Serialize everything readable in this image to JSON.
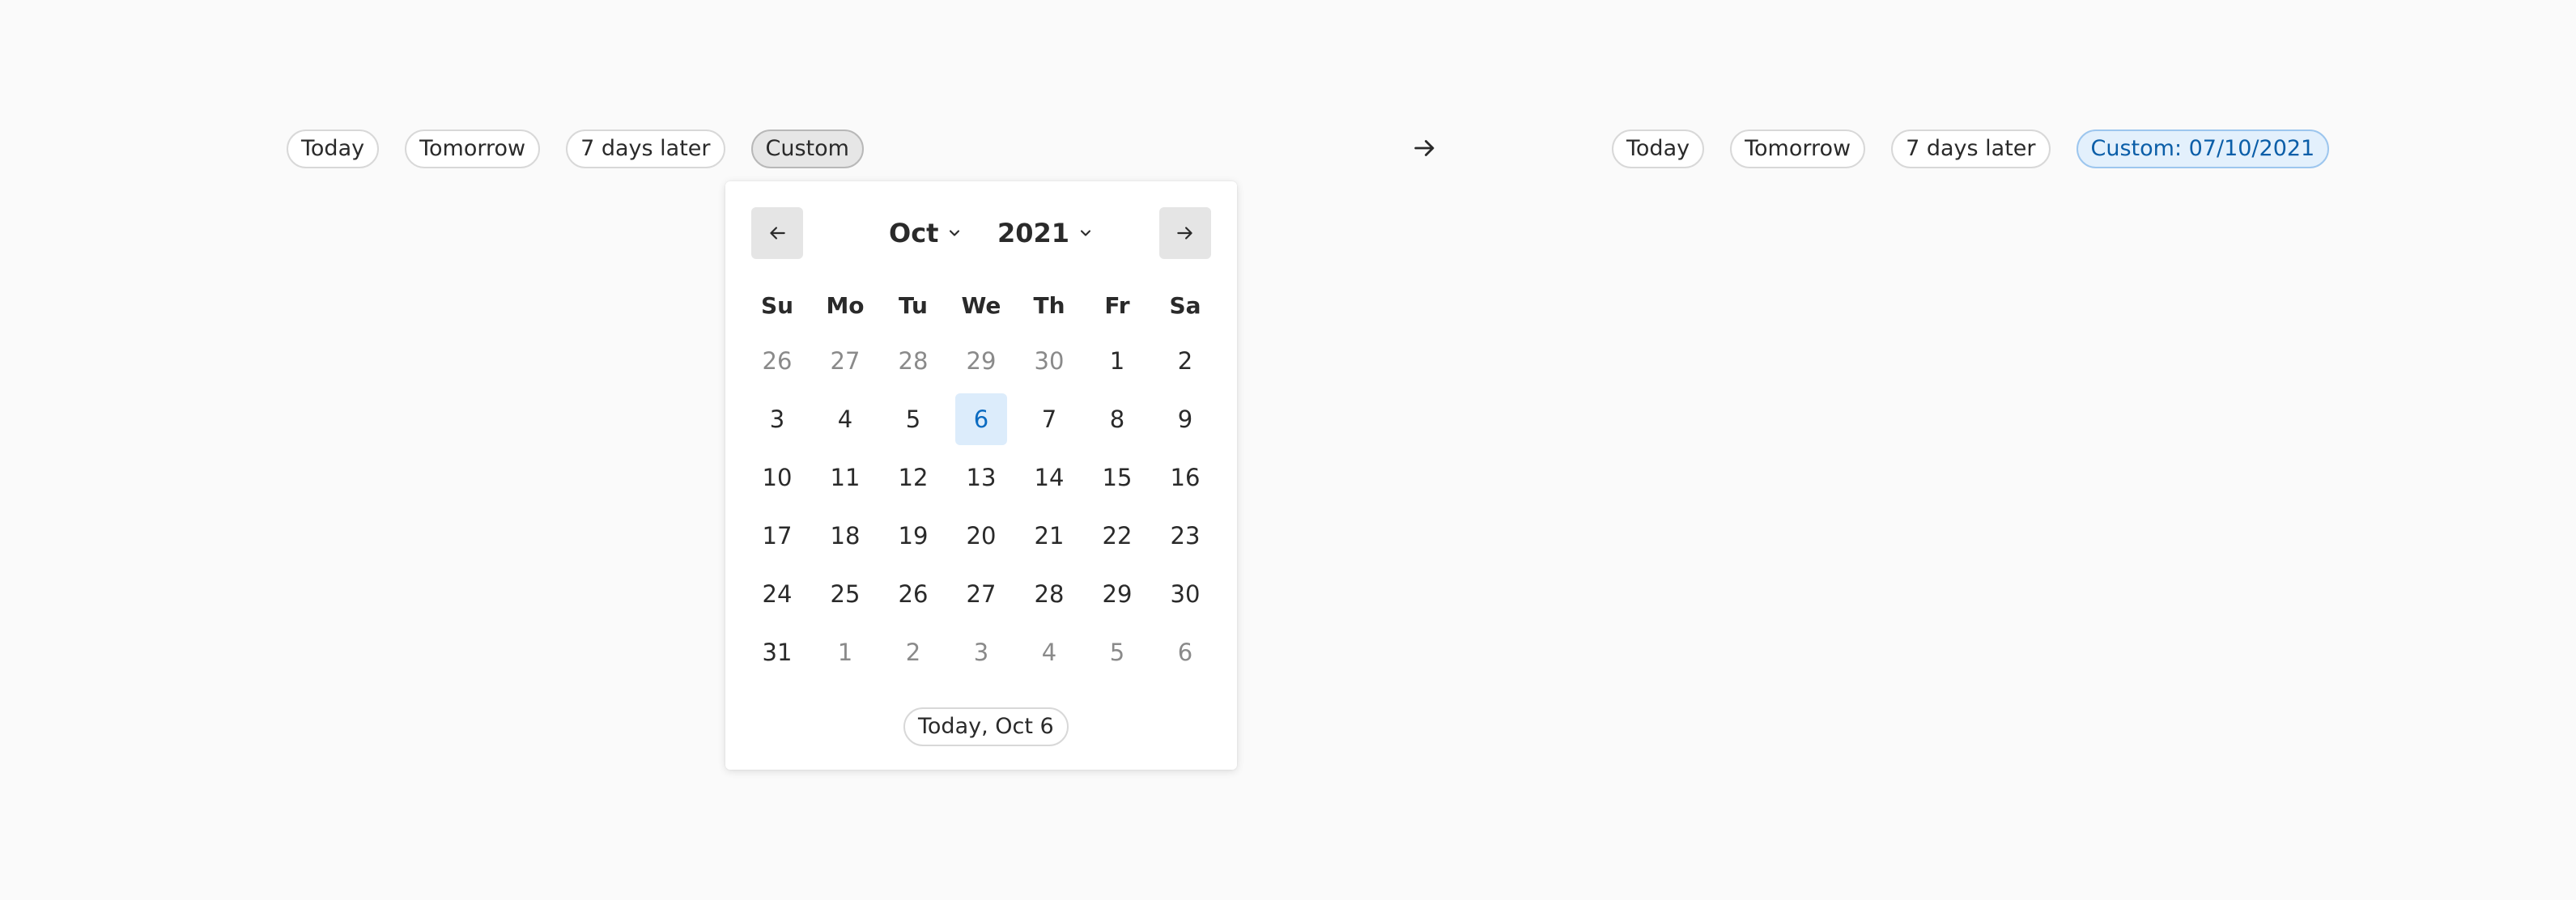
{
  "left_chips": [
    {
      "label": "Today"
    },
    {
      "label": "Tomorrow"
    },
    {
      "label": "7 days later"
    },
    {
      "label": "Custom"
    }
  ],
  "arrow_icon": "arrow-right-icon",
  "right_chips": [
    {
      "label": "Today"
    },
    {
      "label": "Tomorrow"
    },
    {
      "label": "7 days later"
    },
    {
      "label": "Custom: 07/10/2021"
    }
  ],
  "calendar": {
    "prev_icon": "arrow-left-icon",
    "next_icon": "arrow-right-icon",
    "month": "Oct",
    "year": "2021",
    "weekdays": [
      "Su",
      "Mo",
      "Tu",
      "We",
      "Th",
      "Fr",
      "Sa"
    ],
    "weeks": [
      [
        {
          "d": "26",
          "out": true
        },
        {
          "d": "27",
          "out": true
        },
        {
          "d": "28",
          "out": true
        },
        {
          "d": "29",
          "out": true
        },
        {
          "d": "30",
          "out": true
        },
        {
          "d": "1"
        },
        {
          "d": "2"
        }
      ],
      [
        {
          "d": "3"
        },
        {
          "d": "4"
        },
        {
          "d": "5"
        },
        {
          "d": "6",
          "today": true
        },
        {
          "d": "7"
        },
        {
          "d": "8"
        },
        {
          "d": "9"
        }
      ],
      [
        {
          "d": "10"
        },
        {
          "d": "11"
        },
        {
          "d": "12"
        },
        {
          "d": "13"
        },
        {
          "d": "14"
        },
        {
          "d": "15"
        },
        {
          "d": "16"
        }
      ],
      [
        {
          "d": "17"
        },
        {
          "d": "18"
        },
        {
          "d": "19"
        },
        {
          "d": "20"
        },
        {
          "d": "21"
        },
        {
          "d": "22"
        },
        {
          "d": "23"
        }
      ],
      [
        {
          "d": "24"
        },
        {
          "d": "25"
        },
        {
          "d": "26"
        },
        {
          "d": "27"
        },
        {
          "d": "28"
        },
        {
          "d": "29"
        },
        {
          "d": "30"
        }
      ],
      [
        {
          "d": "31"
        },
        {
          "d": "1",
          "out": true
        },
        {
          "d": "2",
          "out": true
        },
        {
          "d": "3",
          "out": true
        },
        {
          "d": "4",
          "out": true
        },
        {
          "d": "5",
          "out": true
        },
        {
          "d": "6",
          "out": true
        }
      ]
    ],
    "today_button": "Today, Oct 6"
  },
  "colors": {
    "background": "#fafafa",
    "accent": "#0b6bc1",
    "accent_bg": "#dcecfb"
  }
}
